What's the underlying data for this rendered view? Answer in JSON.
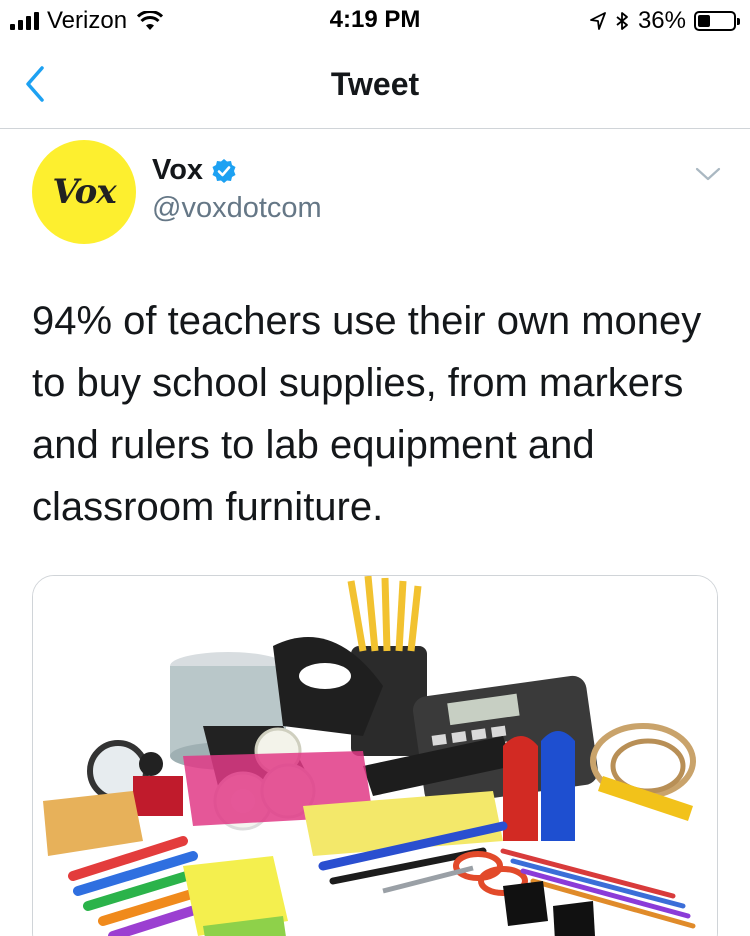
{
  "status_bar": {
    "carrier": "Verizon",
    "time": "4:19 PM",
    "battery_percent": "36%",
    "battery_level": 0.36,
    "icons": [
      "signal-icon",
      "wifi-icon",
      "location-icon",
      "bluetooth-icon",
      "battery-icon"
    ]
  },
  "nav": {
    "title": "Tweet",
    "back_icon": "chevron-left-icon"
  },
  "tweet": {
    "avatar_text": "Vox",
    "name": "Vox",
    "handle": "@voxdotcom",
    "verified": true,
    "text": "94% of teachers use their own money to buy school supplies, from markers and rulers to lab equipment and classroom furniture.",
    "accent_color": "#1da1f2",
    "avatar_color": "#fdef2f"
  }
}
